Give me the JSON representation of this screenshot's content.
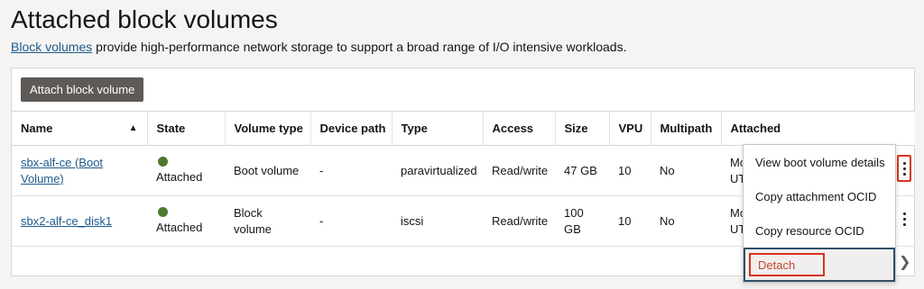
{
  "page": {
    "title": "Attached block volumes",
    "description_link": "Block volumes",
    "description_rest": " provide high-performance network storage to support a broad range of I/O intensive workloads."
  },
  "toolbar": {
    "attach_button": "Attach block volume"
  },
  "table": {
    "headers": [
      "Name",
      "State",
      "Volume type",
      "Device path",
      "Type",
      "Access",
      "Size",
      "VPU",
      "Multipath",
      "Attached"
    ],
    "sort_indicator": "▲",
    "rows": [
      {
        "name": "sbx-alf-ce (Boot Volume)",
        "state": "Attached",
        "volume_type": "Boot volume",
        "device_path": "-",
        "type": "paravirtualized",
        "access": "Read/write",
        "size": "47 GB",
        "vpu": "10",
        "multipath": "No",
        "attached_line1": "Mo",
        "attached_line2": "UT"
      },
      {
        "name": "sbx2-alf-ce_disk1",
        "state": "Attached",
        "volume_type": "Block volume",
        "device_path": "-",
        "type": "iscsi",
        "access": "Read/write",
        "size": "100 GB",
        "vpu": "10",
        "multipath": "No",
        "attached_line1": "Mo",
        "attached_line2": "UT"
      }
    ]
  },
  "menu": {
    "items": [
      "View boot volume details",
      "Copy attachment OCID",
      "Copy resource OCID",
      "Detach"
    ]
  },
  "colors": {
    "state_attached": "#4e7a2e",
    "link": "#1f5a8c",
    "highlight": "#d7341f",
    "focus": "#2f4f6c"
  },
  "icons": {
    "row_actions": "kebab-menu-icon",
    "sort": "sort-ascending-icon",
    "scroll_right": "chevron-right-icon"
  }
}
